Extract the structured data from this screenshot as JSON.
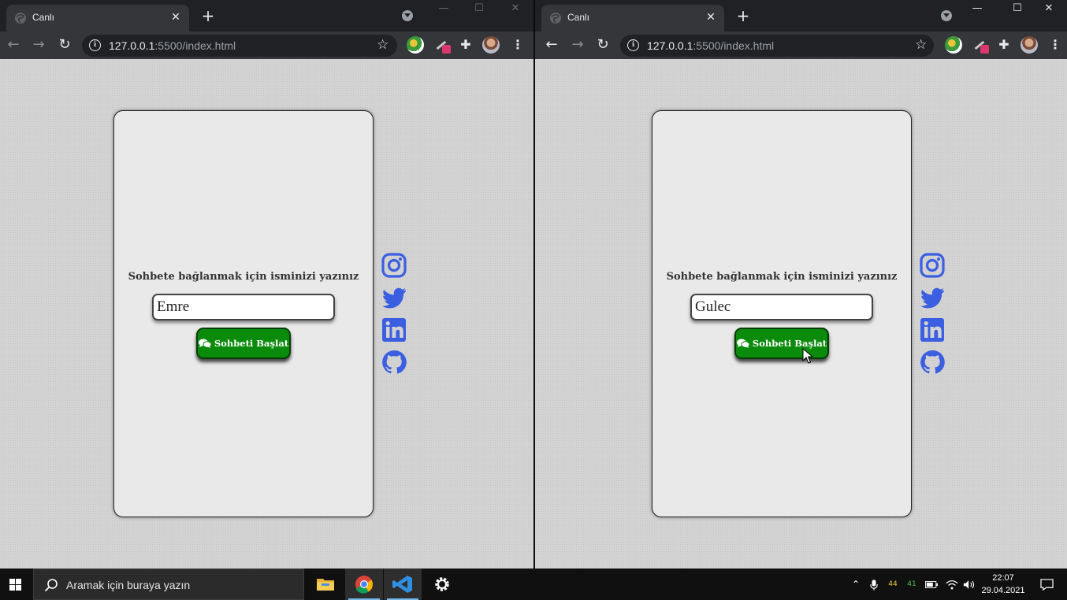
{
  "windows": [
    {
      "tab_title": "Canlı",
      "url_host": "127.0.0.1",
      "url_rest": ":5500/index.html",
      "prompt": "Sohbete bağlanmak için isminizi yazınız",
      "name_value": "Emre",
      "button_label": "Sohbeti Başlat"
    },
    {
      "tab_title": "Canlı",
      "url_host": "127.0.0.1",
      "url_rest": ":5500/index.html",
      "prompt": "Sohbete bağlanmak için isminizi yazınız",
      "name_value": "Gulec",
      "button_label": "Sohbeti Başlat"
    }
  ],
  "taskbar": {
    "search_placeholder": "Aramak için buraya yazın",
    "tray_values": [
      "44",
      "41"
    ],
    "time": "22:07",
    "date": "29.04.2021"
  },
  "colors": {
    "button_green": "#0b8b0b",
    "social_blue": "#3b5fe0"
  }
}
